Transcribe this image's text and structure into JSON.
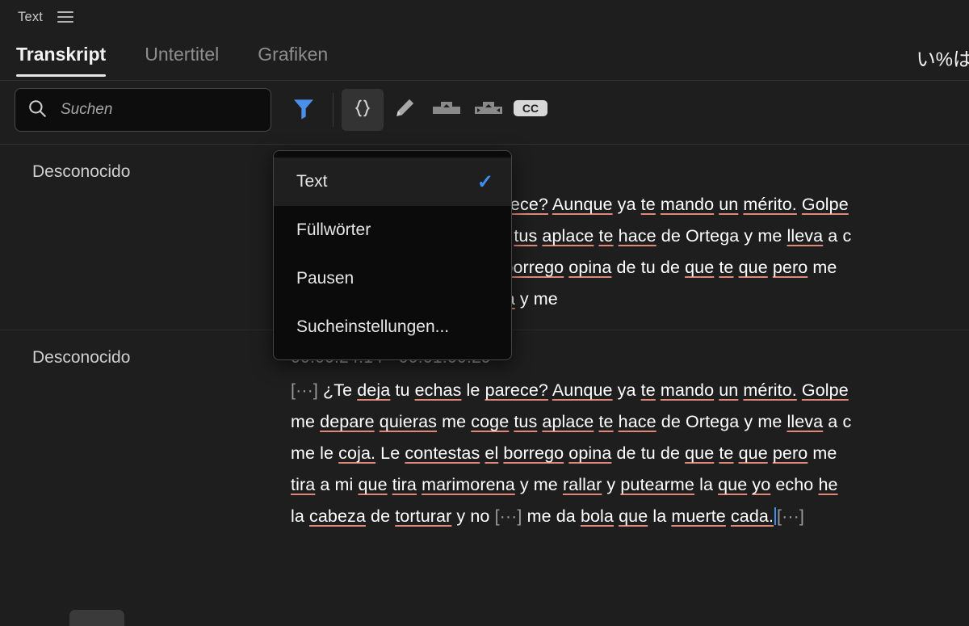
{
  "panel": {
    "title": "Text",
    "menu_icon": "hamburger-icon"
  },
  "tabs": [
    {
      "label": "Transkript",
      "active": true
    },
    {
      "label": "Untertitel",
      "active": false
    },
    {
      "label": "Grafiken",
      "active": false
    }
  ],
  "tabs_right_text": "い%は",
  "toolbar": {
    "search_placeholder": "Suchen",
    "search_value": "",
    "search_icon": "search-icon",
    "filter_icon": "filter-funnel-icon",
    "filter_color": "#4a90e8",
    "braces_icon": "curly-braces-icon",
    "pencil_icon": "pencil-edit-icon",
    "clip_icon": "merge-clips-icon",
    "clip_split_icon": "split-clips-icon",
    "cc_label": "CC"
  },
  "filter_menu": {
    "items": [
      {
        "label": "Text",
        "checked": true
      },
      {
        "label": "Füllwörter",
        "checked": false
      },
      {
        "label": "Pausen",
        "checked": false
      },
      {
        "label": "Sucheinstellungen...",
        "checked": false
      }
    ],
    "check_glyph": "✓",
    "check_color": "#3d8ef5"
  },
  "transcript": {
    "blocks": [
      {
        "speaker": "Desconocido",
        "timecode": "00:00:24:14 - 00:01:00:29",
        "timecode_visible": "24:14",
        "lines": [
          "[···] ¿Te deja tu echas le parece? Aunque ya te mando un mérito. Golpe",
          "me depare quieras me coge tus aplace te hace de Ortega y me lleva a c",
          "me le coja. Le contestas el borrego opina de tu de que te que pero me ",
          "tira a mi que tira marimorena y me"
        ]
      },
      {
        "speaker": "Desconocido",
        "timecode": "00:00:24:14 - 00:01:00:29",
        "lines": [
          "[···] ¿Te deja tu echas le parece? Aunque ya te mando un mérito. Golpe",
          "me depare quieras me coge tus aplace te hace de Ortega y me lleva a c",
          "me le coja. Le contestas el borrego opina de tu de que te que pero me ",
          "tira a mi que tira marimorena y me rallar y putearme la que yo echo he",
          "la cabeza de torturar y no [···] me da bola que la muerte cada.[···]"
        ]
      }
    ]
  }
}
